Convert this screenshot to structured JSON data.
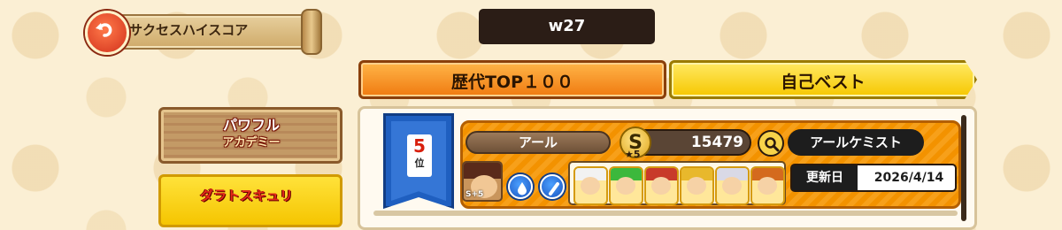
{
  "header": {
    "back_label": "サクセスハイスコア",
    "user_id": "w27"
  },
  "side_menu": {
    "academy_logo_line1": "パワフル",
    "academy_logo_line2": "アカデミー",
    "dramatic_logo": "ダラトスキュリ"
  },
  "tabs": [
    {
      "label": "歴代TOP１００",
      "active": true
    },
    {
      "label": "自己ベスト",
      "active": false
    }
  ],
  "entry": {
    "rank": "5",
    "rank_suffix": "位",
    "player_name": "アール",
    "rank_letter": "S",
    "stars": "★5",
    "score": "15479",
    "team": "アールケミスト",
    "avatar_level": "S+5",
    "update_label": "更新日",
    "update_date": "2026/4/14"
  },
  "icons": [
    "back-arrow-icon",
    "magnify-icon",
    "drop-icon",
    "bat-icon"
  ],
  "colors": {
    "tab_active": "#f39200",
    "tab_inactive": "#f6c700",
    "rank_banner": "#1f5fc0",
    "row_bg": "#f39200"
  }
}
